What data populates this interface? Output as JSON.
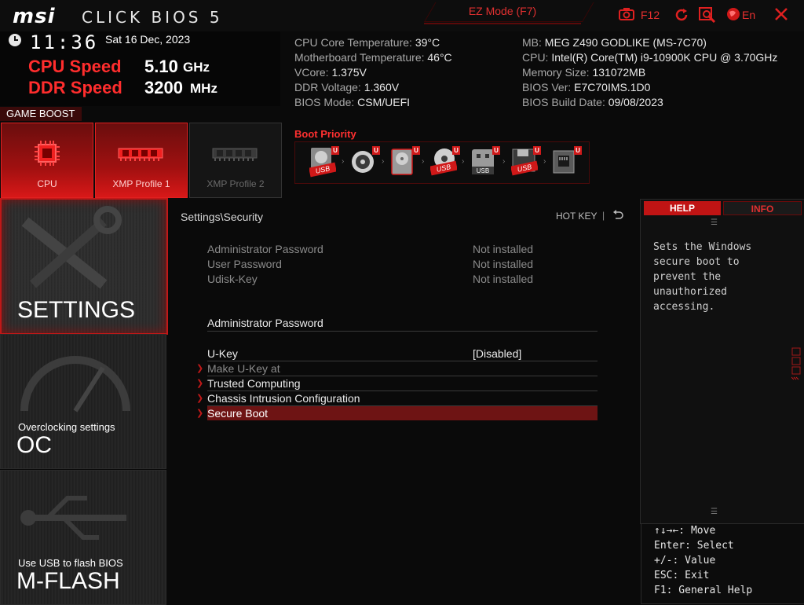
{
  "header": {
    "brand": "msi",
    "product": "CLICK BIOS 5",
    "ez_mode_label": "EZ Mode (F7)",
    "screenshot_key": "F12",
    "language": "En"
  },
  "clock": {
    "time": "11:36",
    "date": "Sat  16 Dec, 2023"
  },
  "speed": {
    "cpu_label": "CPU Speed",
    "cpu_value": "5.10",
    "cpu_unit": "GHz",
    "ddr_label": "DDR Speed",
    "ddr_value": "3200",
    "ddr_unit": "MHz"
  },
  "sysinfo_left": [
    {
      "label": "CPU Core Temperature:",
      "value": "39°C"
    },
    {
      "label": "Motherboard Temperature:",
      "value": "46°C"
    },
    {
      "label": "VCore:",
      "value": "1.375V"
    },
    {
      "label": "DDR Voltage:",
      "value": "1.360V"
    },
    {
      "label": "BIOS Mode:",
      "value": "CSM/UEFI"
    }
  ],
  "sysinfo_right": [
    {
      "label": "MB:",
      "value": "MEG Z490 GODLIKE (MS-7C70)"
    },
    {
      "label": "CPU:",
      "value": "Intel(R) Core(TM) i9-10900K CPU @ 3.70GHz"
    },
    {
      "label": "Memory Size:",
      "value": "131072MB"
    },
    {
      "label": "BIOS Ver:",
      "value": "E7C70IMS.1D0"
    },
    {
      "label": "BIOS Build Date:",
      "value": "09/08/2023"
    }
  ],
  "game_boost": {
    "label": "GAME BOOST",
    "profiles": [
      {
        "label": "CPU",
        "active": true,
        "icon": "cpu-chip-icon"
      },
      {
        "label": "XMP Profile 1",
        "active": true,
        "icon": "memory-module-icon"
      },
      {
        "label": "XMP Profile 2",
        "active": false,
        "icon": "memory-module-icon"
      }
    ]
  },
  "boot_priority": {
    "label": "Boot Priority",
    "badge": "U",
    "devices": [
      {
        "icon": "usb-hdd-icon",
        "tag": "USB"
      },
      {
        "icon": "optical-disc-icon",
        "tag": ""
      },
      {
        "icon": "hdd-icon",
        "tag": ""
      },
      {
        "icon": "usb-cd-icon",
        "tag": "USB"
      },
      {
        "icon": "usb-key-icon",
        "tag": "USB"
      },
      {
        "icon": "usb-floppy-icon",
        "tag": "USB"
      },
      {
        "icon": "network-icon",
        "tag": ""
      }
    ]
  },
  "menu": {
    "settings": "SETTINGS",
    "oc_caption": "Overclocking settings",
    "oc": "OC",
    "mflash_caption": "Use USB to flash BIOS",
    "mflash": "M-FLASH"
  },
  "main": {
    "breadcrumb": "Settings\\Security",
    "hotkey": "HOT KEY",
    "status_rows": [
      {
        "label": "Administrator Password",
        "value": "Not installed"
      },
      {
        "label": "User Password",
        "value": "Not installed"
      },
      {
        "label": "Udisk-Key",
        "value": "Not installed"
      }
    ],
    "admin_section": "Administrator Password",
    "ukey": {
      "label": "U-Key",
      "value": "[Disabled]"
    },
    "submenus": [
      "Make U-Key at",
      "Trusted Computing",
      "Chassis Intrusion Configuration",
      "Secure Boot"
    ]
  },
  "help": {
    "tab_help": "HELP",
    "tab_info": "INFO",
    "lines": [
      "Sets the Windows",
      "secure boot to",
      "prevent the",
      "unauthorized",
      "accessing."
    ],
    "keys": [
      "↑↓→←: Move",
      "Enter: Select",
      "+/-: Value",
      "ESC: Exit",
      "F1: General Help"
    ]
  }
}
